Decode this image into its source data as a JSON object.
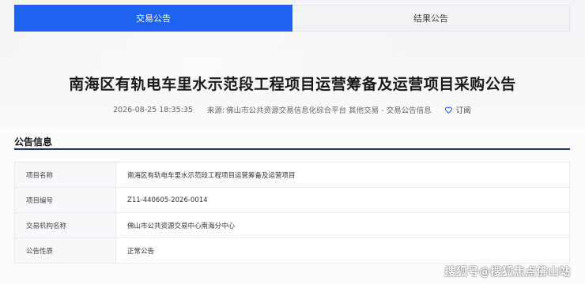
{
  "tabs": [
    {
      "label": "交易公告",
      "active": true
    },
    {
      "label": "结果公告",
      "active": false
    }
  ],
  "title": "南海区有轨电车里水示范段工程项目运营筹备及运营项目采购公告",
  "meta": {
    "date": "2026-08-25 18:35:35",
    "source_label": "来源:",
    "source": "佛山市公共资源交易信息化综合平台 其他交易 - 交易公告信息",
    "subscribe": "订阅"
  },
  "section": {
    "title": "公告信息"
  },
  "info_rows": [
    {
      "key": "项目名称",
      "value": "南海区有轨电车里水示范段工程项目运营筹备及运营项目"
    },
    {
      "key": "项目编号",
      "value": "Z11-440605-2026-0014"
    },
    {
      "key": "交易机构名称",
      "value": "佛山市公共资源交易中心南海分中心"
    },
    {
      "key": "公告性质",
      "value": "正常公告"
    }
  ],
  "watermark": "搜狐号@搜狐焦点佛山站",
  "colors": {
    "accent": "#1e63f0",
    "rule": "#1a3a6b"
  },
  "icons": {
    "subscribe": "heart-icon"
  }
}
